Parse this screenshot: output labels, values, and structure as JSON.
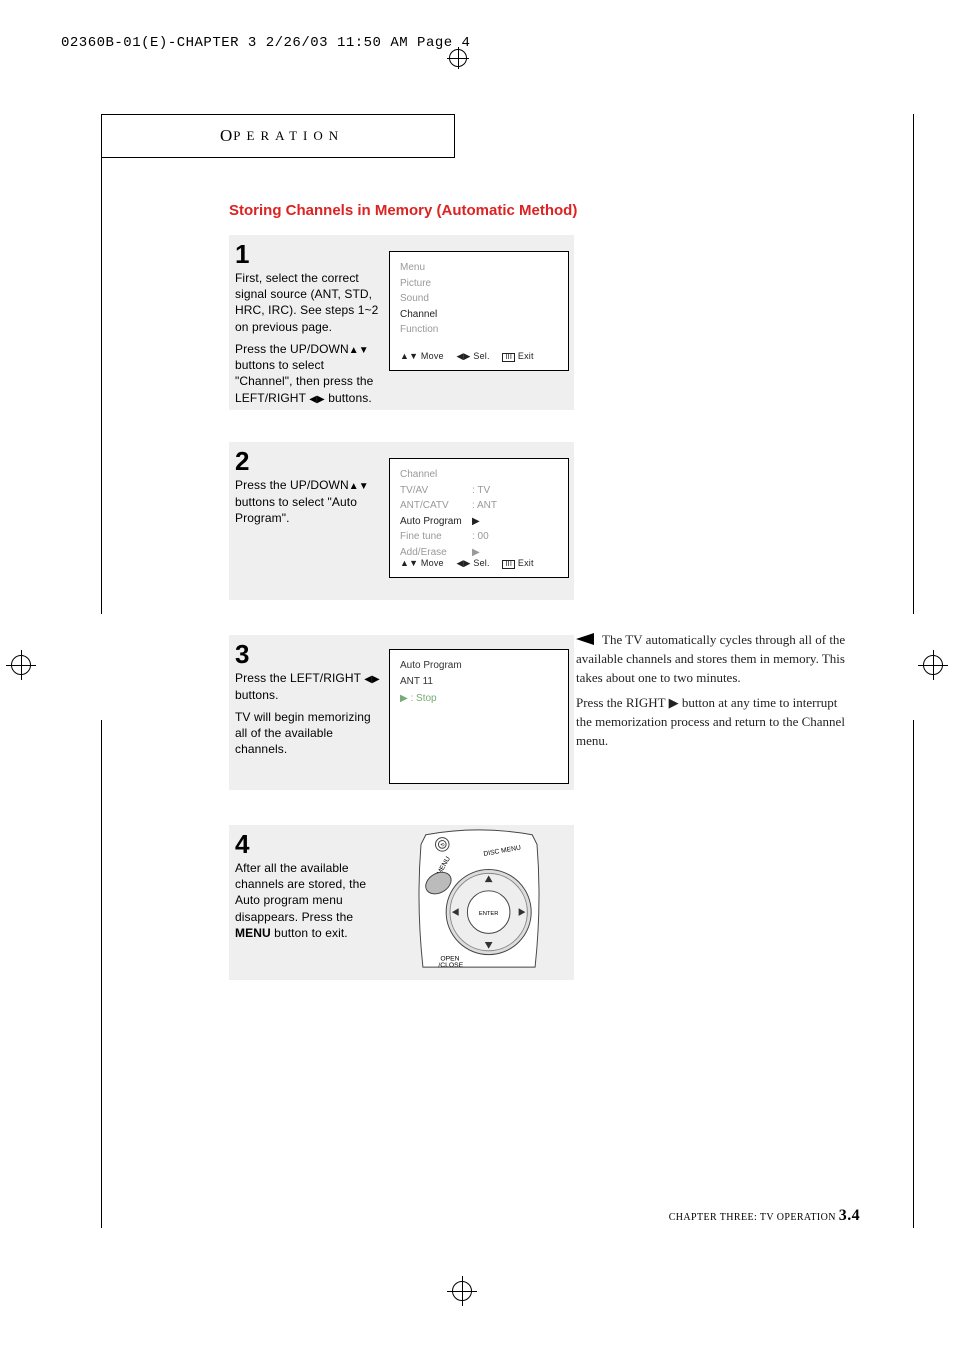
{
  "header_line": "02360B-01(E)-CHAPTER 3  2/26/03  11:50 AM  Page 4",
  "tab_label": "PERATION",
  "tab_cap": "O",
  "section_title": "Storing Channels in Memory (Automatic Method)",
  "steps": {
    "s1": {
      "num": "1",
      "p1": "First, select the correct signal source (ANT, STD, HRC, IRC). See steps 1~2 on previous page.",
      "p2a": "Press the UP/DOWN",
      "p2b": " buttons to select \"Channel\", then press the LEFT/RIGHT ",
      "p2c": " buttons."
    },
    "s2": {
      "num": "2",
      "p1a": "Press the UP/DOWN",
      "p1b": " buttons to select  \"Auto Program\"."
    },
    "s3": {
      "num": "3",
      "p1a": "Press the LEFT/RIGHT ",
      "p1b": " buttons.",
      "p2": " TV will begin memorizing all of the available channels."
    },
    "s4": {
      "num": "4",
      "p1a": "After all the available channels are stored, the Auto program menu disappears. Press the ",
      "p1b": "MENU",
      "p1c": " button to exit."
    }
  },
  "osd1": {
    "title": "Menu",
    "items": [
      "Picture",
      "Sound",
      "Channel",
      "Function"
    ],
    "hl_index": 2,
    "foot_move": "Move",
    "foot_sel": "Sel.",
    "foot_exit": "Exit"
  },
  "osd2": {
    "title": "Channel",
    "rows": [
      {
        "lab": "TV/AV",
        "val": ": TV"
      },
      {
        "lab": "ANT/CATV",
        "val": ": ANT"
      },
      {
        "lab": "Auto Program",
        "val": "▶"
      },
      {
        "lab": "Fine tune",
        "val": ": 00"
      },
      {
        "lab": "Add/Erase",
        "val": "▶"
      }
    ],
    "hl_index": 2,
    "foot_move": "Move",
    "foot_sel": "Sel.",
    "foot_exit": "Exit"
  },
  "osd3": {
    "l1": "Auto Program",
    "l2": "ANT 11",
    "l3": "▶ :  Stop"
  },
  "sidebar": {
    "p1": "The TV automatically cycles through all of the available channels and stores them in memory. This takes about one to two minutes.",
    "p2a": "Press the RIGHT ",
    "p2b": " button at any time to interrupt the memorization process and return to the Channel menu."
  },
  "footer": {
    "chapter": "CHAPTER THREE: TV OPERATION ",
    "page": "3.4"
  },
  "remote_labels": {
    "disc_menu": "DISC MENU",
    "menu": "MENU",
    "open": "OPEN",
    "close": "/CLOSE",
    "enter": "ENTER"
  }
}
